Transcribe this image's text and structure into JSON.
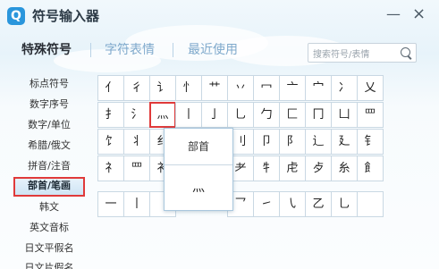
{
  "app": {
    "title": "符号输入器",
    "logo_letter": "Q"
  },
  "window_controls": {
    "minimize": "—",
    "close": "×"
  },
  "tabs": [
    {
      "label": "特殊符号",
      "active": true
    },
    {
      "label": "字符表情",
      "active": false
    },
    {
      "label": "最近使用",
      "active": false
    }
  ],
  "search": {
    "placeholder": "搜索符号/表情"
  },
  "sidebar": {
    "items": [
      {
        "label": "标点符号"
      },
      {
        "label": "数字序号"
      },
      {
        "label": "数字/单位"
      },
      {
        "label": "希腊/俄文"
      },
      {
        "label": "拼音/注音"
      },
      {
        "label": "部首/笔画",
        "selected": true
      },
      {
        "label": "韩文"
      },
      {
        "label": "英文音标"
      },
      {
        "label": "日文平假名"
      },
      {
        "label": "日文片假名"
      }
    ]
  },
  "grid": {
    "rows": [
      [
        "亻",
        "彳",
        "讠",
        "忄",
        "艹",
        "丷",
        "冖",
        "亠",
        "宀",
        "冫",
        "乂"
      ],
      [
        "扌",
        "氵",
        "灬",
        "丨",
        "亅",
        "乚",
        "勹",
        "匚",
        "冂",
        "凵",
        "罒"
      ],
      [
        "饣",
        "丬",
        "纟",
        "",
        "",
        "刂",
        "卩",
        "阝",
        "辶",
        "廴",
        "钅"
      ],
      [
        "礻",
        "罒",
        "衤",
        "",
        "",
        "耂",
        "牜",
        "虍",
        "歺",
        "糸",
        "飠"
      ],
      [
        "一",
        "丨",
        "",
        "",
        "",
        "乛",
        "㇀",
        "㇂",
        "乙",
        "乚",
        ""
      ]
    ],
    "selected": {
      "row": 1,
      "col": 2
    }
  },
  "popup": {
    "header": "部首",
    "glyph": "灬"
  },
  "colors": {
    "accent": "#2a96dc",
    "selection_red": "#e03a3a"
  }
}
